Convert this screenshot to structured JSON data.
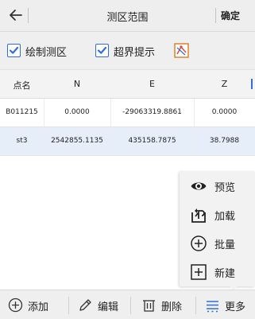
{
  "header": {
    "title": "测区范围",
    "confirm_label": "确定"
  },
  "options": {
    "draw_area_label": "绘制测区",
    "draw_area_checked": true,
    "out_of_bounds_label": "超界提示",
    "out_of_bounds_checked": true
  },
  "table": {
    "columns": [
      "点名",
      "N",
      "E",
      "Z"
    ],
    "rows": [
      {
        "name": "B011215",
        "n": "0.0000",
        "e": "-29063319.8861",
        "z": "0.0000",
        "selected": false
      },
      {
        "name": "st3",
        "n": "2542855.1135",
        "e": "435158.7875",
        "z": "38.7988",
        "selected": true
      }
    ]
  },
  "menu": {
    "items": [
      {
        "label": "预览",
        "icon": "eye-icon"
      },
      {
        "label": "加载",
        "icon": "load-icon"
      },
      {
        "label": "批量",
        "icon": "plus-circle-icon"
      },
      {
        "label": "新建",
        "icon": "plus-square-icon"
      }
    ]
  },
  "toolbar": {
    "add_label": "添加",
    "edit_label": "编辑",
    "delete_label": "删除",
    "more_label": "更多"
  },
  "colors": {
    "accent": "#2f6fd6",
    "selected_row": "#e5eef9",
    "bar_bg": "#efefef"
  }
}
